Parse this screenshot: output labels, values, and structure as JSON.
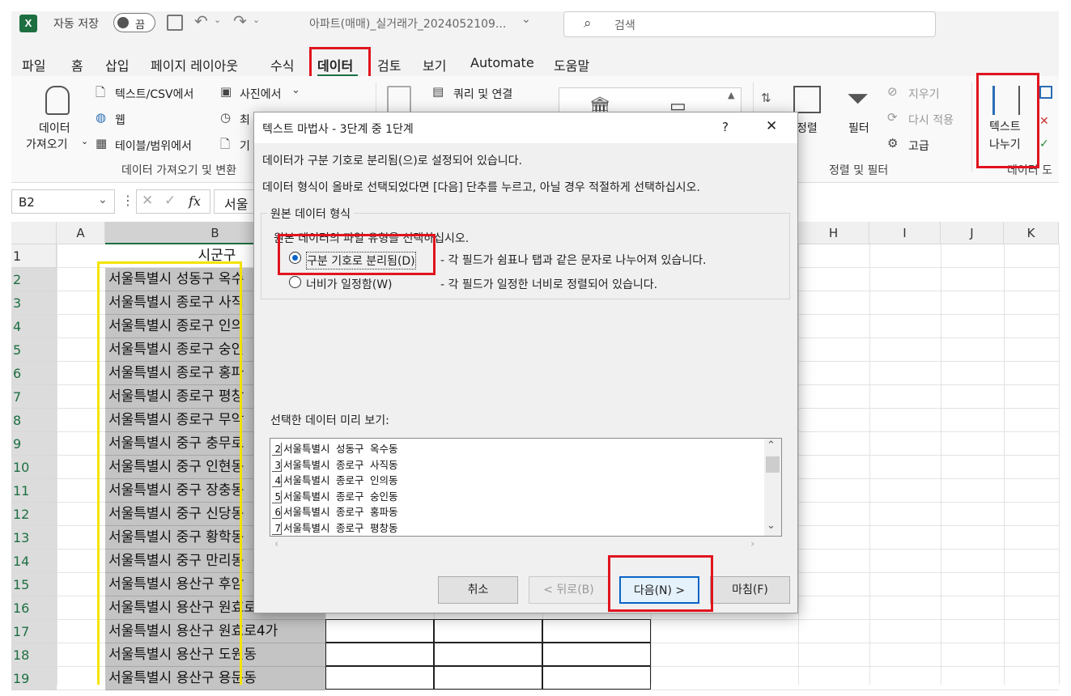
{
  "titlebar": {
    "autosave_label": "자동 저장",
    "autosave_state": "끔",
    "filename": "아파트(매매)_실거래가_2024052109...",
    "search_placeholder": "검색"
  },
  "tabs": [
    "파일",
    "홈",
    "삽입",
    "페이지 레이아웃",
    "수식",
    "데이터",
    "검토",
    "보기",
    "Automate",
    "도움말"
  ],
  "ribbon": {
    "get_data": "데이터",
    "get_data2": "가져오기",
    "from_text_csv": "텍스트/CSV에서",
    "web": "웹",
    "from_table": "테이블/범위에서",
    "from_picture": "사진에서",
    "recent": "최",
    "existing": "기",
    "group_get": "데이터 가져오기 및 변환",
    "queries": "쿼리 및 연결",
    "sort": "정렬",
    "filter": "필터",
    "clear": "지우기",
    "reapply": "다시 적용",
    "advanced": "고급",
    "group_sort": "정렬 및 필터",
    "text_to_columns_1": "텍스트",
    "text_to_columns_2": "나누기",
    "group_data_tools": "데이터 도"
  },
  "formula_bar": {
    "name_box": "B2",
    "fx": "fx",
    "content": "서울"
  },
  "columns": [
    "A",
    "B",
    "H",
    "I",
    "J",
    "K"
  ],
  "rows": [
    {
      "num": "1",
      "b": "시군구"
    },
    {
      "num": "2",
      "b": "서울특별시 성동구 옥수"
    },
    {
      "num": "3",
      "b": "서울특별시 종로구 사직"
    },
    {
      "num": "4",
      "b": "서울특별시 종로구 인의"
    },
    {
      "num": "5",
      "b": "서울특별시 종로구 숭인"
    },
    {
      "num": "6",
      "b": "서울특별시 종로구 홍파"
    },
    {
      "num": "7",
      "b": "서울특별시 종로구 평창"
    },
    {
      "num": "8",
      "b": "서울특별시 종로구 무악"
    },
    {
      "num": "9",
      "b": "서울특별시 중구 충무로"
    },
    {
      "num": "10",
      "b": "서울특별시 중구 인현동"
    },
    {
      "num": "11",
      "b": "서울특별시 중구 장충동"
    },
    {
      "num": "12",
      "b": "서울특별시 중구 신당동"
    },
    {
      "num": "13",
      "b": "서울특별시 중구 황학동"
    },
    {
      "num": "14",
      "b": "서울특별시 중구 만리동"
    },
    {
      "num": "15",
      "b": "서울특별시 용산구 후암"
    },
    {
      "num": "16",
      "b": "서울특별시 용산구 원효로"
    },
    {
      "num": "17",
      "b": "서울특별시 용산구 원효로4가"
    },
    {
      "num": "18",
      "b": "서울특별시 용산구 도원동"
    },
    {
      "num": "19",
      "b": "서울특별시 용산구 용문동"
    }
  ],
  "dialog": {
    "title": "텍스트 마법사 - 3단계 중 1단계",
    "help": "?",
    "close": "✕",
    "line1": "데이터가 구분 기호로 분리됨(으)로 설정되어 있습니다.",
    "line2": "데이터 형식이 올바로 선택되었다면 [다음] 단추를 누르고, 아닐 경우 적절하게 선택하십시오.",
    "group_title": "원본 데이터 형식",
    "group_hint": "원본 데이터의 파일 유형을 선택하십시오.",
    "opt_delim": "구분 기호로 분리됨(D)",
    "opt_delim_desc": "- 각 필드가 쉼표나 탭과 같은 문자로 나누어져 있습니다.",
    "opt_fixed": "너비가 일정함(W)",
    "opt_fixed_desc": "- 각 필드가 일정한 너비로 정렬되어 있습니다.",
    "preview_label": "선택한 데이터 미리 보기:",
    "preview": [
      {
        "n": "2",
        "t": "서울특별시 성동구 옥수동"
      },
      {
        "n": "3",
        "t": "서울특별시 종로구 사직동"
      },
      {
        "n": "4",
        "t": "서울특별시 종로구 인의동"
      },
      {
        "n": "5",
        "t": "서울특별시 종로구 숭인동"
      },
      {
        "n": "6",
        "t": "서울특별시 종로구 홍파동"
      },
      {
        "n": "7",
        "t": "서울특별시 종로구 평창동"
      }
    ],
    "btn_cancel": "취소",
    "btn_back": "< 뒤로(B)",
    "btn_next": "다음(N) >",
    "btn_finish": "마침(F)"
  }
}
